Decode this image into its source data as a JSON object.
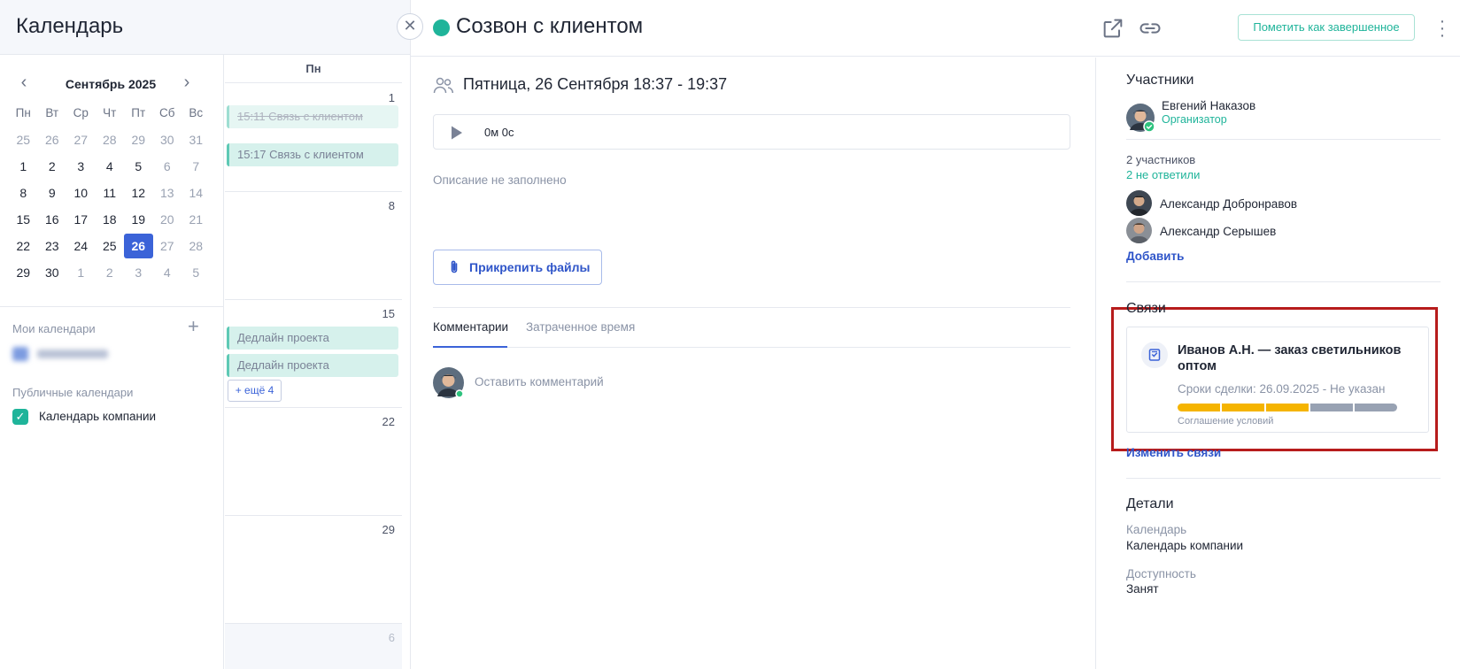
{
  "app": {
    "title": "Календарь"
  },
  "mini_calendar": {
    "month_label": "Сентябрь 2025",
    "weekdays": [
      "Пн",
      "Вт",
      "Ср",
      "Чт",
      "Пт",
      "Сб",
      "Вс"
    ],
    "weeks": [
      [
        {
          "d": "25",
          "m": true
        },
        {
          "d": "26",
          "m": true
        },
        {
          "d": "27",
          "m": true
        },
        {
          "d": "28",
          "m": true
        },
        {
          "d": "29",
          "m": true
        },
        {
          "d": "30",
          "m": true
        },
        {
          "d": "31",
          "m": true
        }
      ],
      [
        {
          "d": "1"
        },
        {
          "d": "2"
        },
        {
          "d": "3"
        },
        {
          "d": "4"
        },
        {
          "d": "5"
        },
        {
          "d": "6",
          "m": true
        },
        {
          "d": "7",
          "m": true
        }
      ],
      [
        {
          "d": "8"
        },
        {
          "d": "9"
        },
        {
          "d": "10"
        },
        {
          "d": "11"
        },
        {
          "d": "12"
        },
        {
          "d": "13",
          "m": true
        },
        {
          "d": "14",
          "m": true
        }
      ],
      [
        {
          "d": "15"
        },
        {
          "d": "16"
        },
        {
          "d": "17"
        },
        {
          "d": "18"
        },
        {
          "d": "19"
        },
        {
          "d": "20",
          "m": true
        },
        {
          "d": "21",
          "m": true
        }
      ],
      [
        {
          "d": "22"
        },
        {
          "d": "23"
        },
        {
          "d": "24"
        },
        {
          "d": "25"
        },
        {
          "d": "26",
          "today": true
        },
        {
          "d": "27",
          "m": true
        },
        {
          "d": "28",
          "m": true
        }
      ],
      [
        {
          "d": "29"
        },
        {
          "d": "30"
        },
        {
          "d": "1",
          "m": true
        },
        {
          "d": "2",
          "m": true
        },
        {
          "d": "3",
          "m": true
        },
        {
          "d": "4",
          "m": true
        },
        {
          "d": "5",
          "m": true
        }
      ]
    ]
  },
  "sidebar": {
    "my_calendars_label": "Мои календари",
    "public_calendars_label": "Публичные календари",
    "company_calendar_label": "Календарь компании"
  },
  "week_view": {
    "column_header": "Пн",
    "day_numbers": [
      "1",
      "8",
      "15",
      "22",
      "29",
      "6"
    ],
    "events_day1": [
      "15:11 Связь с клиентом",
      "15:17 Связь с клиентом"
    ],
    "events_day15": [
      "Дедлайн проекта",
      "Дедлайн проекта"
    ],
    "more_label": "+ ещё 4"
  },
  "event": {
    "title": "Созвон с клиентом",
    "status_color": "#1fb49a",
    "mark_complete_label": "Пометить как завершенное",
    "date_text": "Пятница, 26 Сентября 18:37 - 19:37",
    "recording_time": "0м 0с",
    "description_placeholder": "Описание не заполнено",
    "attach_label": "Прикрепить файлы",
    "tabs": [
      "Комментарии",
      "Затраченное время"
    ],
    "comment_placeholder": "Оставить комментарий"
  },
  "participants": {
    "title": "Участники",
    "organizer": {
      "name": "Евгений Наказов",
      "role": "Организатор"
    },
    "count_label": "2 участников",
    "no_answer_label": "2 не ответили",
    "members": [
      "Александр Добронравов",
      "Александр Серышев"
    ],
    "add_label": "Добавить"
  },
  "links": {
    "title": "Связи",
    "deal": {
      "title": "Иванов А.Н. — заказ светильников оптом",
      "terms": "Сроки сделки: 26.09.2025 - Не указан",
      "stage": "Соглашение условий",
      "progress_segments": [
        "#f5b400",
        "#f5b400",
        "#f5b400",
        "#98a2b3",
        "#98a2b3"
      ]
    },
    "edit_label": "Изменить связи"
  },
  "details": {
    "title": "Детали",
    "calendar_label": "Календарь",
    "calendar_value": "Календарь компании",
    "availability_label": "Доступность",
    "availability_value": "Занят"
  }
}
